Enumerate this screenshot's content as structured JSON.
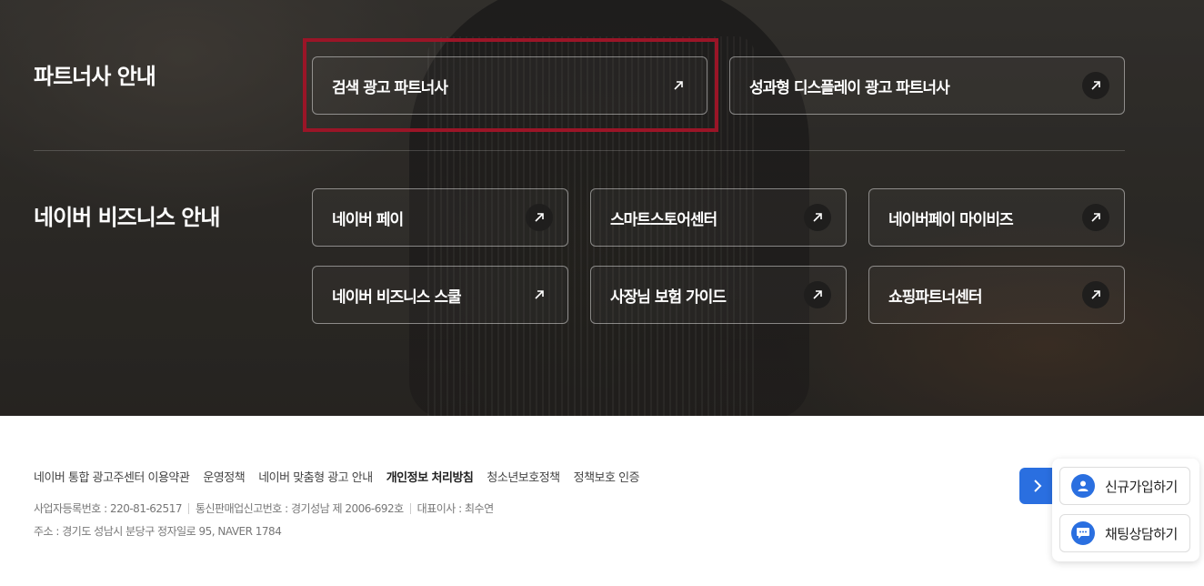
{
  "partners": {
    "title": "파트너사 안내",
    "cards": [
      {
        "label": "검색 광고 파트너사"
      },
      {
        "label": "성과형 디스플레이 광고 파트너사"
      }
    ]
  },
  "business": {
    "title": "네이버 비즈니스 안내",
    "cards": [
      {
        "label": "네이버 페이"
      },
      {
        "label": "스마트스토어센터"
      },
      {
        "label": "네이버페이 마이비즈"
      },
      {
        "label": "네이버 비즈니스 스쿨"
      },
      {
        "label": "사장님 보험 가이드"
      },
      {
        "label": "쇼핑파트너센터"
      }
    ]
  },
  "footer": {
    "links": [
      {
        "label": "네이버 통합 광고주센터 이용약관"
      },
      {
        "label": "운영정책"
      },
      {
        "label": "네이버 맞춤형 광고 안내"
      },
      {
        "label": "개인정보 처리방침"
      },
      {
        "label": "청소년보호정책"
      },
      {
        "label": "정책보호 인증"
      }
    ],
    "business_reg": "사업자등록번호 : 220-81-62517",
    "mail_order": "통신판매업신고번호 : 경기성남 제 2006-692호",
    "ceo": "대표이사 : 최수연",
    "address": "주소 : 경기도 성남시 분당구 정자일로 95, NAVER 1784"
  },
  "floating": {
    "signup_label": "신규가입하기",
    "chat_label": "채팅상담하기"
  },
  "colors": {
    "accent": "#2a6fe0",
    "highlight_border": "#9a1527"
  },
  "icons": [
    "arrow-up-right-icon",
    "chevron-right-icon",
    "user-icon",
    "chat-bubble-icon"
  ]
}
